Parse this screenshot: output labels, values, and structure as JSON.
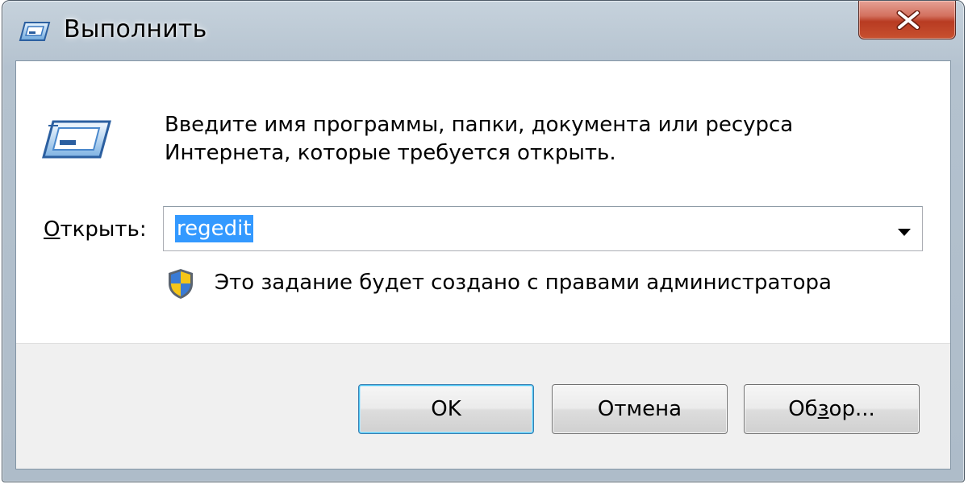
{
  "window": {
    "title": "Выполнить",
    "icon": "run-icon"
  },
  "titlebar": {
    "close_icon": "close-icon",
    "colors": {
      "close_button": "#c8512f"
    }
  },
  "dialog": {
    "description_line1": "Введите имя программы, папки, документа или ресурса",
    "description_line2": "Интернета, которые требуется открыть.",
    "open_label_prefix": "О",
    "open_label_rest": "ткрыть:",
    "open_value": "regedit",
    "admin_icon": "uac-shield-icon",
    "admin_note": "Это задание будет создано с правами администратора"
  },
  "buttons": {
    "ok_label": "OK",
    "cancel_label": "Отмена",
    "browse_pre": "Об",
    "browse_accel": "з",
    "browse_post": "ор..."
  },
  "colors": {
    "selection": "#3399ff",
    "default_button_border": "#3c7fb1"
  }
}
